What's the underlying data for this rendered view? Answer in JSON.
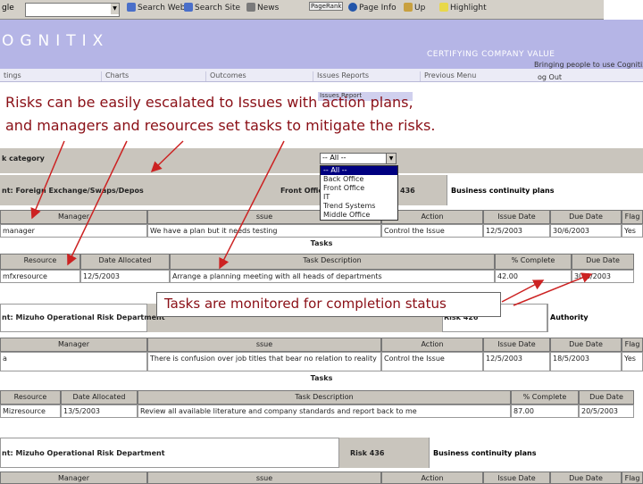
{
  "browser_toolbar": {
    "search_box_label": "gle",
    "items": [
      "Search Web",
      "Search Site",
      "News",
      "PageRank",
      "Page Info",
      "Up",
      "Highlight"
    ],
    "icons": [
      "search-web-icon",
      "search-site-icon",
      "news-icon",
      "pagerank-icon",
      "page-info-icon",
      "up-icon",
      "highlight-icon"
    ]
  },
  "banner": {
    "logo": "OGNITIX",
    "tagline": "CERTIFYING COMPANY VALUE",
    "welcome": "Bringing people to use Cognitix  Fo",
    "logout": "og Out",
    "color": "#b5b5e6"
  },
  "nav": [
    "tings",
    "Charts",
    "Outcomes",
    "Issues Reports",
    "Previous Menu"
  ],
  "issue_report_tag": "Issues Report",
  "annotations": {
    "top_line1": "Risks can be easily escalated to Issues with action plans,",
    "top_line2": "and managers and resources set tasks to mitigate the risks.",
    "callout": "Tasks are monitored for completion status",
    "color": "#8a0f16"
  },
  "category": {
    "label": "k category",
    "selected": "-- All --",
    "options": [
      "-- All --",
      "Back Office",
      "Front Office",
      "IT",
      "Trend Systems",
      "Middle Office"
    ]
  },
  "block1": {
    "risk_label": "nt: Foreign Exchange/Swaps/Depos",
    "front_office": "Front Offic",
    "risk_no": "436",
    "risk_name": "Business continuity plans",
    "issue_headers": [
      "Manager",
      "ssue",
      "Action",
      "Issue Date",
      "Due Date",
      "Flag"
    ],
    "issue_row": [
      "manager",
      "We have a plan but it needs testing",
      "Control the Issue",
      "12/5/2003",
      "30/6/2003",
      "Yes"
    ],
    "tasks_title": "Tasks",
    "task_headers": [
      "Resource",
      "Date Allocated",
      "Task Description",
      "% Complete",
      "Due Date"
    ],
    "task_row": [
      "mfxresource",
      "12/5/2003",
      "Arrange a planning meeting with all heads of departments",
      "42.00",
      "30/6/2003"
    ]
  },
  "block2": {
    "dept": "nt: Mizuho Operational Risk Department",
    "risk_no": "Risk 426",
    "risk_name": "Authority",
    "issue_headers": [
      "Manager",
      "ssue",
      "Action",
      "Issue Date",
      "Due Date",
      "Flag"
    ],
    "issue_row": [
      "a",
      "There is confusion over job titles that bear no relation to reality",
      "Control the Issue",
      "12/5/2003",
      "18/5/2003",
      "Yes"
    ],
    "tasks_title": "Tasks",
    "task_headers": [
      "Resource",
      "Date Allocated",
      "Task Description",
      "% Complete",
      "Due Date"
    ],
    "task_row": [
      "Mizresource",
      "13/5/2003",
      "Review all available literature and company standards and report back to me",
      "87.00",
      "20/5/2003"
    ]
  },
  "block3": {
    "dept": "nt: Mizuho Operational Risk Department",
    "risk_no": "Risk 436",
    "risk_name": "Business continuity plans",
    "issue_headers": [
      "Manager",
      "ssue",
      "Action",
      "Issue Date",
      "Due Date",
      "Flag"
    ]
  }
}
